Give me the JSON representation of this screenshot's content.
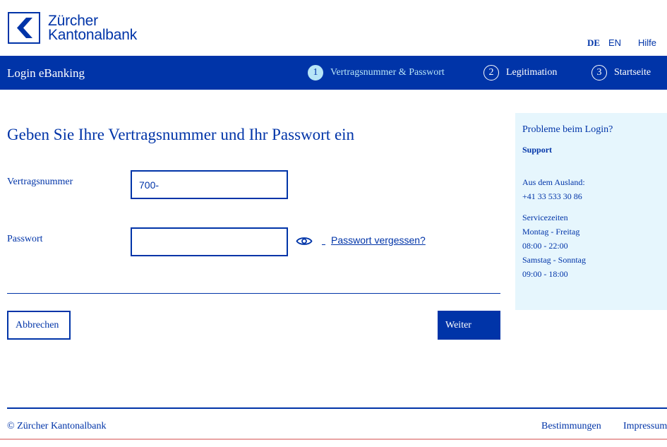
{
  "header": {
    "logo_line1": "Zürcher",
    "logo_line2": "Kantonalbank",
    "languages": [
      "DE",
      "EN"
    ],
    "help": "Hilfe"
  },
  "navbar": {
    "title": "Login eBanking",
    "steps": [
      {
        "num": "1",
        "label": "Vertragsnummer & Passwort",
        "active": true
      },
      {
        "num": "2",
        "label": "Legitimation",
        "active": false
      },
      {
        "num": "3",
        "label": "Startseite",
        "active": false
      }
    ]
  },
  "form": {
    "heading": "Geben Sie Ihre Vertragsnummer und Ihr Passwort ein",
    "contract_label": "Vertragsnummer",
    "contract_value": "700-",
    "password_label": "Passwort",
    "password_value": "",
    "forgot_link": "Passwort vergessen?",
    "cancel_label": "Abbrechen",
    "next_label": "Weiter"
  },
  "sidebar": {
    "title": "Probleme beim Login?",
    "support": "Support",
    "lines": [
      "Aus dem Ausland:",
      "+41 33 533 30 86",
      "Servicezeiten",
      "Montag - Freitag",
      "08:00 - 22:00",
      "Samstag - Sonntag",
      "09:00 - 18:00"
    ]
  },
  "footer": {
    "copyright": "© Zürcher Kantonalbank",
    "links": [
      "Bestimmungen",
      "Impressum"
    ]
  },
  "colors": {
    "brand_blue": "#0034a8",
    "active_step": "#b7e5f7",
    "sidebar_bg": "#e6f6fd"
  }
}
